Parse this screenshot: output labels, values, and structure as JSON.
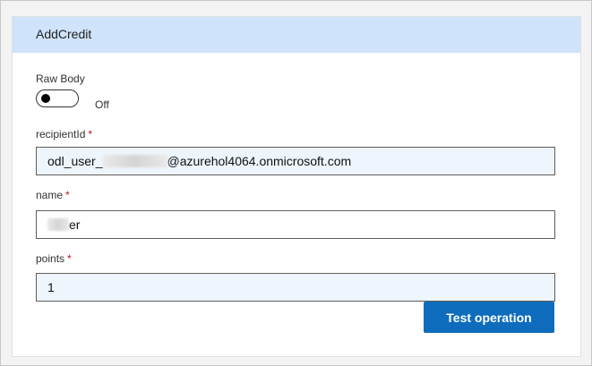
{
  "card": {
    "title": "AddCredit"
  },
  "raw_body": {
    "label": "Raw Body",
    "state": "Off"
  },
  "recipient": {
    "label": "recipientId",
    "required_marker": "*",
    "value_prefix": "odl_user_",
    "value_suffix": "@azurehol4064.onmicrosoft.com"
  },
  "name": {
    "label": "name",
    "required_marker": "*",
    "value_suffix": "er"
  },
  "points": {
    "label": "points",
    "required_marker": "*",
    "value": "1"
  },
  "actions": {
    "test_label": "Test operation"
  },
  "colors": {
    "header_bg": "#cfe3fb",
    "primary_button": "#0f6cbd",
    "required": "#c50f1f",
    "filled_input_bg": "#eef5fd"
  }
}
